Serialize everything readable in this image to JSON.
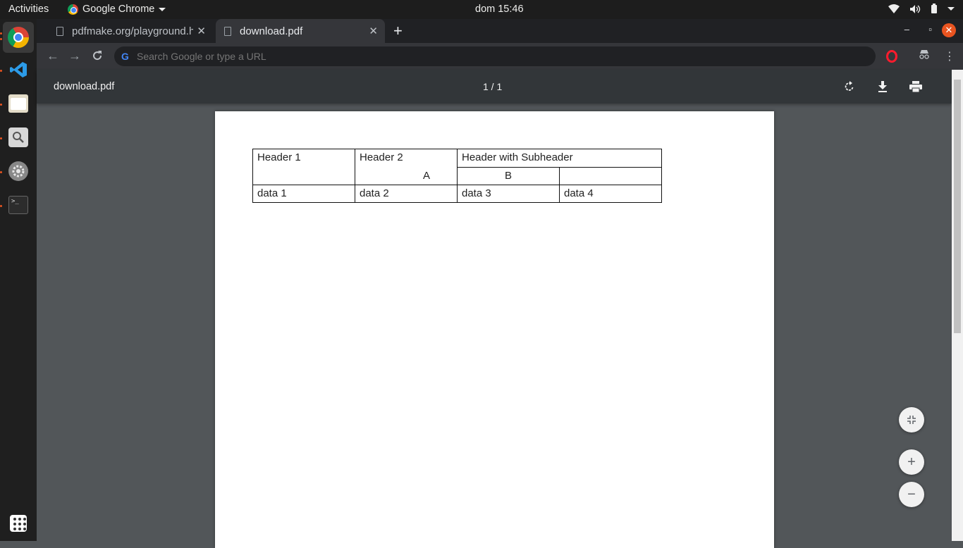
{
  "system": {
    "activities": "Activities",
    "app_name": "Google Chrome",
    "clock": "dom 15:46"
  },
  "dock": {
    "items": [
      "chrome",
      "vscode",
      "files",
      "search",
      "settings",
      "terminal"
    ]
  },
  "tabs": [
    {
      "title": "pdfmake.org/playground.html",
      "active": false
    },
    {
      "title": "download.pdf",
      "active": true
    }
  ],
  "toolbar": {
    "search_placeholder": "Search Google or type a URL"
  },
  "pdf_viewer": {
    "filename": "download.pdf",
    "page_indicator": "1 / 1"
  },
  "document": {
    "table": {
      "header1": "Header 1",
      "header2": "Header 2",
      "header_sub": "Header with Subheader",
      "sub_a": "A",
      "sub_b": "B",
      "row": [
        "data 1",
        "data 2",
        "data 3",
        "data 4"
      ]
    }
  },
  "colors": {
    "viewer_bg": "#525659",
    "pdf_toolbar": "#323639",
    "accent_close": "#e95420"
  }
}
